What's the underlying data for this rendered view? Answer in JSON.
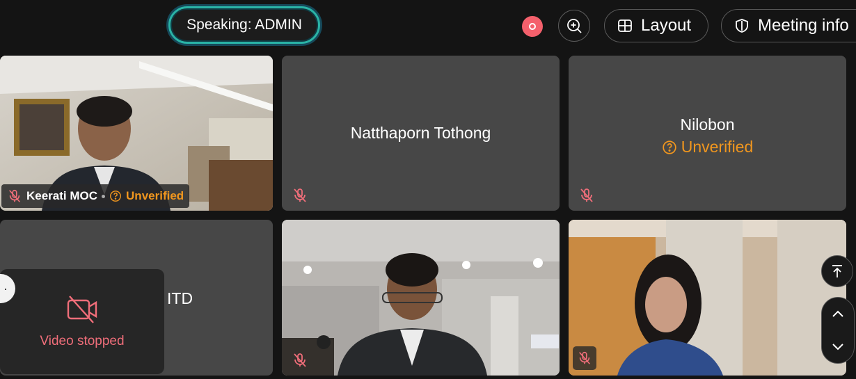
{
  "topbar": {
    "speaking_label": "Speaking: ADMIN",
    "layout_label": "Layout",
    "meeting_info_label": "Meeting info"
  },
  "participants": [
    {
      "name": "Keerati MOC",
      "status": "Unverified",
      "video": "on",
      "muted": true
    },
    {
      "name": "Natthaporn Tothong",
      "video": "off",
      "muted": true
    },
    {
      "name": "Nilobon",
      "status": "Unverified",
      "video": "off",
      "muted": true
    },
    {
      "name": "ITD",
      "video": "off",
      "muted": false
    },
    {
      "name": "",
      "video": "on",
      "muted": true
    },
    {
      "name": "",
      "video": "on",
      "muted": true
    }
  ],
  "self_view": {
    "label": "Video stopped"
  },
  "colors": {
    "tile_bg": "#474747",
    "unverified": "#f0961e",
    "record": "#f4606c",
    "speaking_border": "#2ab3a6"
  },
  "icons": [
    "record-icon",
    "zoom-in-icon",
    "layout-grid-icon",
    "shield-icon",
    "mic-off-icon",
    "help-circle-icon",
    "video-off-icon",
    "scroll-to-top-icon",
    "chevron-up-icon",
    "chevron-down-icon"
  ]
}
